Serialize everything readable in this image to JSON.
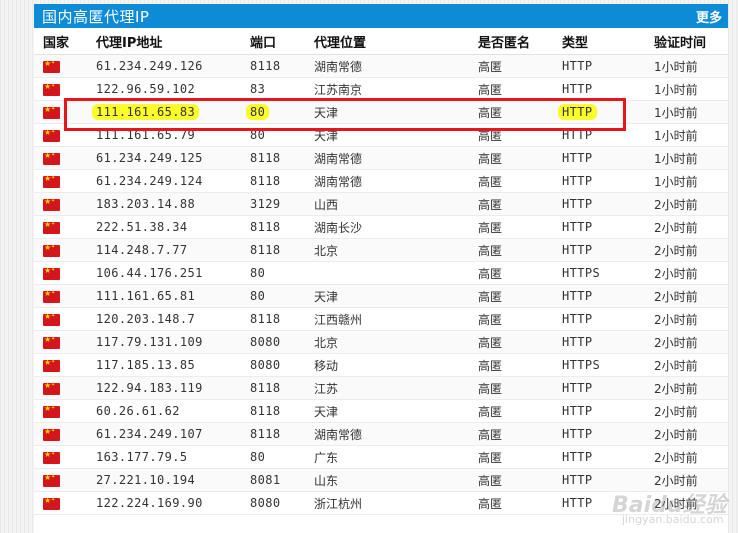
{
  "panel": {
    "title": "国内高匿代理IP",
    "more_label": "更多"
  },
  "columns": {
    "country": "国家",
    "ip": "代理IP地址",
    "port": "端口",
    "location": "代理位置",
    "anonymity": "是否匿名",
    "type": "类型",
    "verified": "验证时间"
  },
  "flag_icon": "china-flag-icon",
  "highlight_color": "#fbfd2a",
  "box_color": "#e8151b",
  "highlighted_row_index": 2,
  "watermark": {
    "brand": "Baidu经验",
    "url": "jingyan.baidu.com"
  },
  "rows": [
    {
      "ip": "61.234.249.126",
      "port": "8118",
      "location": "湖南常德",
      "anonymity": "高匿",
      "type": "HTTP",
      "verified": "1小时前"
    },
    {
      "ip": "122.96.59.102",
      "port": "83",
      "location": "江苏南京",
      "anonymity": "高匿",
      "type": "HTTP",
      "verified": "1小时前"
    },
    {
      "ip": "111.161.65.83",
      "port": "80",
      "location": "天津",
      "anonymity": "高匿",
      "type": "HTTP",
      "verified": "1小时前"
    },
    {
      "ip": "111.161.65.79",
      "port": "80",
      "location": "天津",
      "anonymity": "高匿",
      "type": "HTTP",
      "verified": "1小时前"
    },
    {
      "ip": "61.234.249.125",
      "port": "8118",
      "location": "湖南常德",
      "anonymity": "高匿",
      "type": "HTTP",
      "verified": "1小时前"
    },
    {
      "ip": "61.234.249.124",
      "port": "8118",
      "location": "湖南常德",
      "anonymity": "高匿",
      "type": "HTTP",
      "verified": "1小时前"
    },
    {
      "ip": "183.203.14.88",
      "port": "3129",
      "location": "山西",
      "anonymity": "高匿",
      "type": "HTTP",
      "verified": "2小时前"
    },
    {
      "ip": "222.51.38.34",
      "port": "8118",
      "location": "湖南长沙",
      "anonymity": "高匿",
      "type": "HTTP",
      "verified": "2小时前"
    },
    {
      "ip": "114.248.7.77",
      "port": "8118",
      "location": "北京",
      "anonymity": "高匿",
      "type": "HTTP",
      "verified": "2小时前"
    },
    {
      "ip": "106.44.176.251",
      "port": "80",
      "location": "",
      "anonymity": "高匿",
      "type": "HTTPS",
      "verified": "2小时前"
    },
    {
      "ip": "111.161.65.81",
      "port": "80",
      "location": "天津",
      "anonymity": "高匿",
      "type": "HTTP",
      "verified": "2小时前"
    },
    {
      "ip": "120.203.148.7",
      "port": "8118",
      "location": "江西赣州",
      "anonymity": "高匿",
      "type": "HTTP",
      "verified": "2小时前"
    },
    {
      "ip": "117.79.131.109",
      "port": "8080",
      "location": "北京",
      "anonymity": "高匿",
      "type": "HTTP",
      "verified": "2小时前"
    },
    {
      "ip": "117.185.13.85",
      "port": "8080",
      "location": "移动",
      "anonymity": "高匿",
      "type": "HTTPS",
      "verified": "2小时前"
    },
    {
      "ip": "122.94.183.119",
      "port": "8118",
      "location": "江苏",
      "anonymity": "高匿",
      "type": "HTTP",
      "verified": "2小时前"
    },
    {
      "ip": "60.26.61.62",
      "port": "8118",
      "location": "天津",
      "anonymity": "高匿",
      "type": "HTTP",
      "verified": "2小时前"
    },
    {
      "ip": "61.234.249.107",
      "port": "8118",
      "location": "湖南常德",
      "anonymity": "高匿",
      "type": "HTTP",
      "verified": "2小时前"
    },
    {
      "ip": "163.177.79.5",
      "port": "80",
      "location": "广东",
      "anonymity": "高匿",
      "type": "HTTP",
      "verified": "2小时前"
    },
    {
      "ip": "27.221.10.194",
      "port": "8081",
      "location": "山东",
      "anonymity": "高匿",
      "type": "HTTP",
      "verified": "2小时前"
    },
    {
      "ip": "122.224.169.90",
      "port": "8080",
      "location": "浙江杭州",
      "anonymity": "高匿",
      "type": "HTTP",
      "verified": "2小时前"
    }
  ]
}
